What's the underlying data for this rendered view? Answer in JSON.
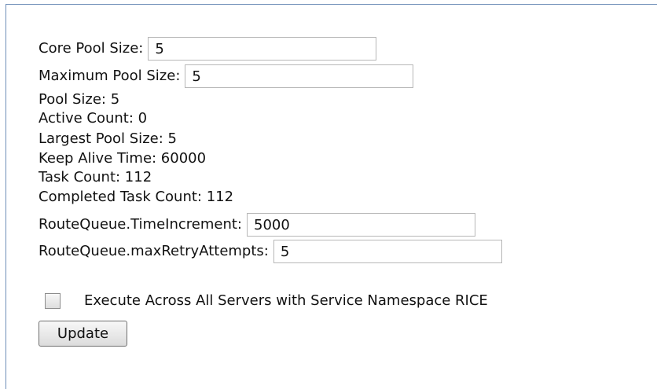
{
  "settings": {
    "core_pool_size": {
      "label": "Core Pool Size:",
      "value": "5"
    },
    "maximum_pool_size": {
      "label": "Maximum Pool Size:",
      "value": "5"
    },
    "pool_size": "Pool Size: 5",
    "active_count": "Active Count: 0",
    "largest_pool_size": "Largest Pool Size: 5",
    "keep_alive_time": "Keep Alive Time: 60000",
    "task_count": "Task Count: 112",
    "completed_task_count": "Completed Task Count: 112",
    "route_queue_time_increment": {
      "label": "RouteQueue.TimeIncrement:",
      "value": "5000"
    },
    "route_queue_max_retry_attempts": {
      "label": "RouteQueue.maxRetryAttempts:",
      "value": "5"
    }
  },
  "execution": {
    "checkbox_label": "Execute Across All Servers with Service Namespace RICE",
    "checked": false
  },
  "actions": {
    "update_label": "Update"
  },
  "icons": {
    "checkbox": "empty-checkbox-icon"
  }
}
